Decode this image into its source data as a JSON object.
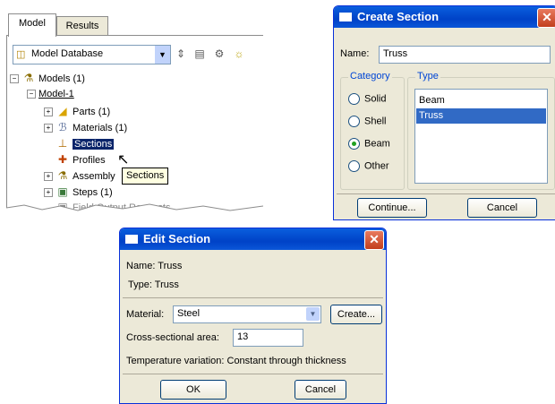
{
  "tree_panel": {
    "tabs": [
      "Model",
      "Results"
    ],
    "database_select": "Model Database",
    "items": [
      {
        "label": "Models (1)"
      },
      {
        "label": "Model-1"
      },
      {
        "label": "Parts (1)"
      },
      {
        "label": "Materials (1)"
      },
      {
        "label": "Sections"
      },
      {
        "label": "Profiles"
      },
      {
        "label": "Assembly"
      },
      {
        "label": "Steps (1)"
      },
      {
        "label": "Field Output Requests"
      }
    ],
    "tooltip": "Sections"
  },
  "create_section": {
    "title": "Create Section",
    "name_label": "Name:",
    "name_value": "Truss",
    "category_label": "Category",
    "type_label": "Type",
    "categories": [
      "Solid",
      "Shell",
      "Beam",
      "Other"
    ],
    "selected_category": "Beam",
    "types": [
      "Beam",
      "Truss"
    ],
    "selected_type": "Truss",
    "continue_label": "Continue...",
    "cancel_label": "Cancel"
  },
  "edit_section": {
    "title": "Edit Section",
    "name_line": "Name:  Truss",
    "type_line": "Type:  Truss",
    "material_label": "Material:",
    "material_value": "Steel",
    "create_label": "Create...",
    "area_label": "Cross-sectional area:",
    "area_value": "13",
    "temp_line": "Temperature variation:  Constant through thickness",
    "ok_label": "OK",
    "cancel_label": "Cancel"
  },
  "colors": {
    "titlebar": "#0054e3",
    "selection": "#316ac5",
    "dialog_bg": "#ece9d8"
  }
}
